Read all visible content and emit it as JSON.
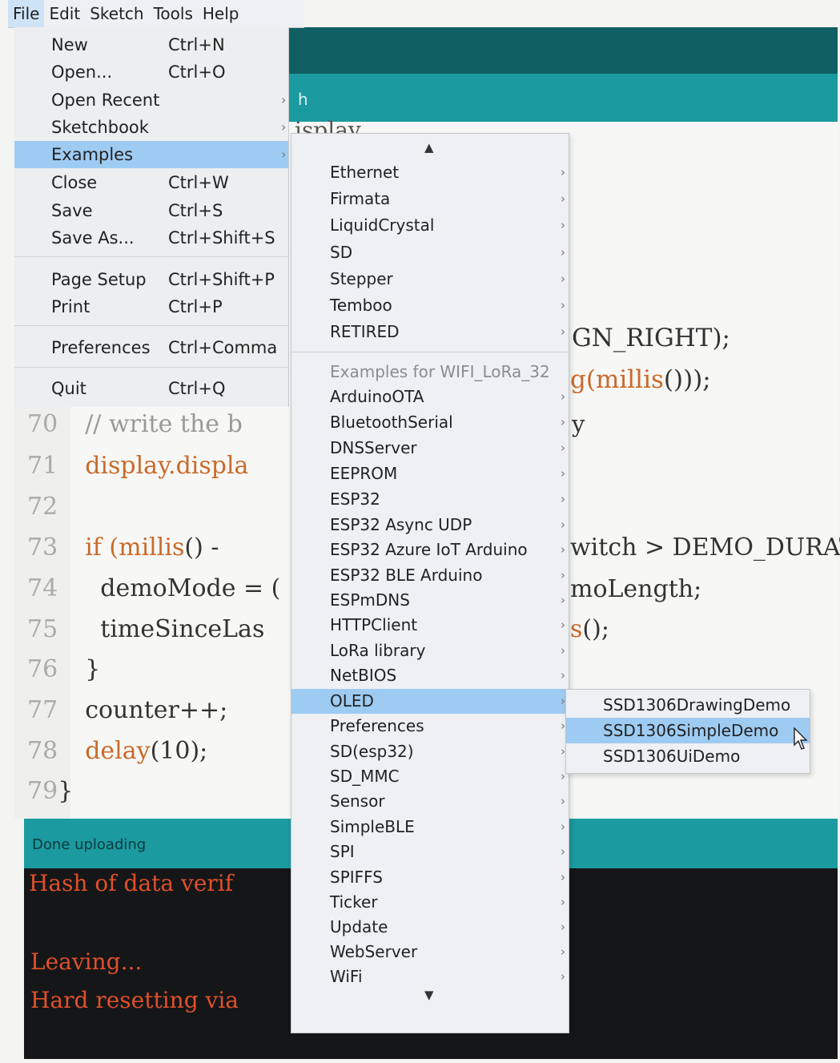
{
  "menubar": [
    "File",
    "Edit",
    "Sketch",
    "Tools",
    "Help"
  ],
  "file_menu": [
    {
      "label": "New",
      "shortcut": "Ctrl+N"
    },
    {
      "label": "Open...",
      "shortcut": "Ctrl+O"
    },
    {
      "label": "Open Recent",
      "shortcut": ""
    },
    {
      "label": "Sketchbook",
      "shortcut": ""
    },
    {
      "label": "Examples",
      "shortcut": ""
    },
    {
      "label": "Close",
      "shortcut": "Ctrl+W"
    },
    {
      "label": "Save",
      "shortcut": "Ctrl+S"
    },
    {
      "label": "Save As...",
      "shortcut": "Ctrl+Shift+S"
    },
    {
      "label": "Page Setup",
      "shortcut": "Ctrl+Shift+P"
    },
    {
      "label": "Print",
      "shortcut": "Ctrl+P"
    },
    {
      "label": "Preferences",
      "shortcut": "Ctrl+Comma"
    },
    {
      "label": "Quit",
      "shortcut": "Ctrl+Q"
    }
  ],
  "examples_menu": {
    "up_arrow": "▲",
    "down_arrow": "▼",
    "builtin": [
      "Ethernet",
      "Firmata",
      "LiquidCrystal",
      "SD",
      "Stepper",
      "Temboo",
      "RETIRED"
    ],
    "section_header": "Examples for WIFI_LoRa_32",
    "board": [
      "ArduinoOTA",
      "BluetoothSerial",
      "DNSServer",
      "EEPROM",
      "ESP32",
      "ESP32 Async UDP",
      "ESP32 Azure IoT Arduino",
      "ESP32 BLE Arduino",
      "ESPmDNS",
      "HTTPClient",
      "LoRa library",
      "NetBIOS",
      "OLED",
      "Preferences",
      "SD(esp32)",
      "SD_MMC",
      "Sensor",
      "SimpleBLE",
      "SPI",
      "SPIFFS",
      "Ticker",
      "Update",
      "WebServer",
      "WiFi"
    ],
    "selected": "OLED"
  },
  "oled_submenu": {
    "items": [
      "SSD1306DrawingDemo",
      "SSD1306SimpleDemo",
      "SSD1306UiDemo"
    ],
    "selected": "SSD1306SimpleDemo"
  },
  "editor": {
    "tab_fragment": "h",
    "lines": [
      {
        "num": "70",
        "code": "// write the b"
      },
      {
        "num": "71",
        "code": "display.displa"
      },
      {
        "num": "72",
        "code": ""
      },
      {
        "num": "73",
        "code_a": "if (",
        "code_b": "millis",
        "code_c": "() -"
      },
      {
        "num": "74",
        "code": "  demoMode = ("
      },
      {
        "num": "75",
        "code": "  timeSinceLas"
      },
      {
        "num": "76",
        "code": "}"
      },
      {
        "num": "77",
        "code": "counter++;"
      },
      {
        "num": "78",
        "code_a": "delay",
        "code_b": "(10);"
      },
      {
        "num": "79",
        "code": "}"
      }
    ],
    "right_fragments": {
      "isplay": "isplay",
      "gn_right": "GN_RIGHT);",
      "millis_a": "g(",
      "millis_b": "millis",
      "millis_c": "()));",
      "y": "y",
      "witch": "witch > DEMO_DURAT",
      "molength": "moLength;",
      "s_a": "s",
      "s_b": "();"
    }
  },
  "status": "Done uploading",
  "console": [
    "Hash of data verif",
    "Leaving...",
    "Hard resetting via"
  ],
  "colors": {
    "teal": "#1b9aa0",
    "dark_teal": "#0f5f63",
    "keyword_orange": "#c96a2b",
    "highlight_blue": "#9ecbf2",
    "console_text": "#e0502a",
    "console_bg": "#151618"
  }
}
